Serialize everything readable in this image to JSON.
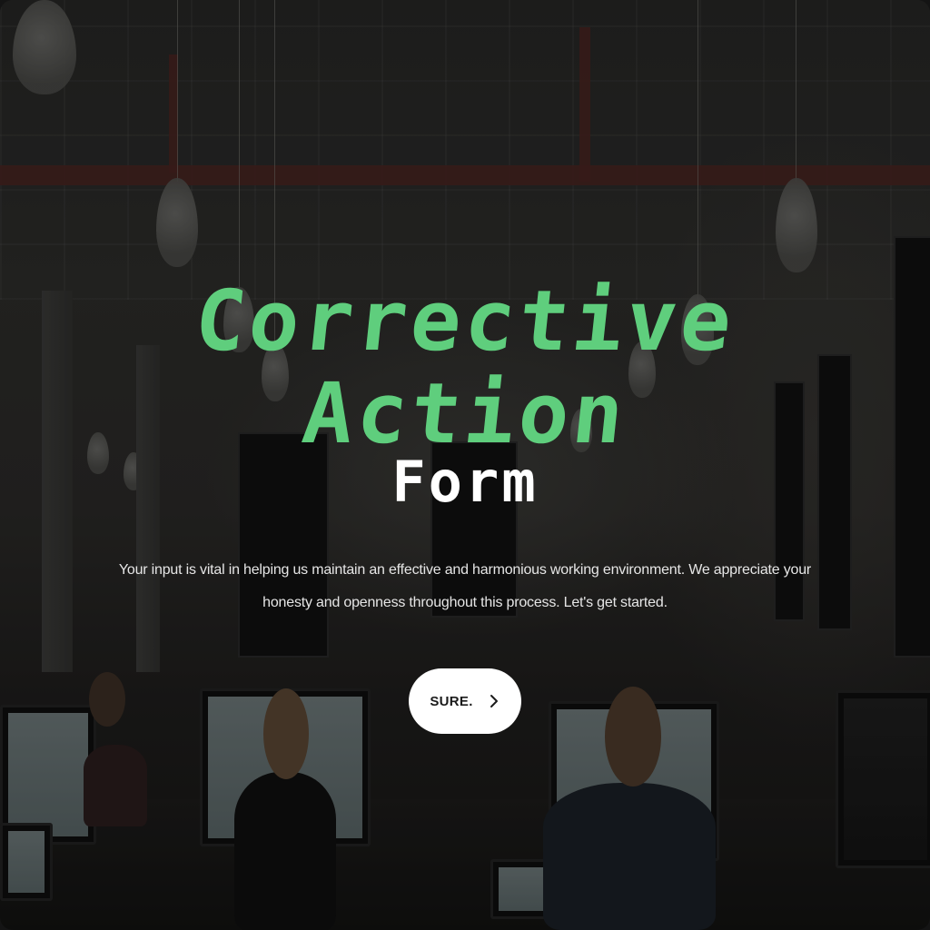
{
  "hero": {
    "title_line_1": "Corrective",
    "title_line_2": "Action",
    "title_line_3": "Form",
    "intro_text": "Your input is vital in helping us maintain an effective and harmonious working environment. We appreciate your honesty and openness throughout this process. Let's get started."
  },
  "start_button": {
    "label": "SURE.",
    "icon": "chevron-right-icon"
  },
  "colors": {
    "title_accent": "#5fce7d",
    "title_secondary": "#ffffff",
    "button_background": "#ffffff",
    "button_text": "#1b1b1b"
  },
  "background": {
    "icon": "office-photo"
  }
}
